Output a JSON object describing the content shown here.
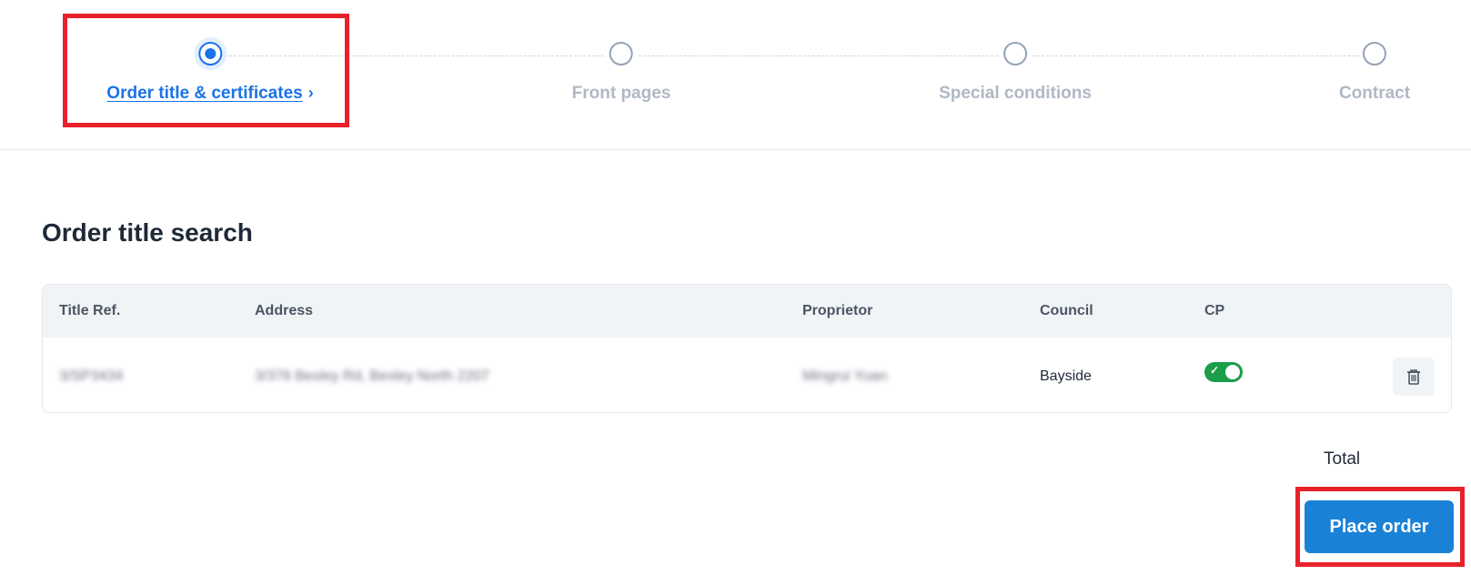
{
  "stepper": {
    "steps": [
      {
        "label": "Order title & certificates",
        "state": "active"
      },
      {
        "label": "Front pages",
        "state": "pending"
      },
      {
        "label": "Special conditions",
        "state": "pending"
      },
      {
        "label": "Contract",
        "state": "pending"
      }
    ],
    "active_chevron": "›"
  },
  "section": {
    "title": "Order title search"
  },
  "table": {
    "headers": [
      "Title Ref.",
      "Address",
      "Proprietor",
      "Council",
      "CP"
    ],
    "rows": [
      {
        "title_ref": "3/SP3434",
        "address": "3/376 Bexley Rd, Bexley North 2207",
        "proprietor": "Mingrui Yuan",
        "council": "Bayside",
        "cp_enabled": true
      }
    ]
  },
  "summary": {
    "total_label": "Total"
  },
  "actions": {
    "place_order_label": "Place order"
  },
  "colors": {
    "accent": "#1a73e8",
    "toggle_on": "#1a9e4a",
    "button": "#1a82d6",
    "highlight": "#e8212b"
  },
  "icons": {
    "delete": "trash-icon",
    "toggle_check": "check-icon"
  }
}
